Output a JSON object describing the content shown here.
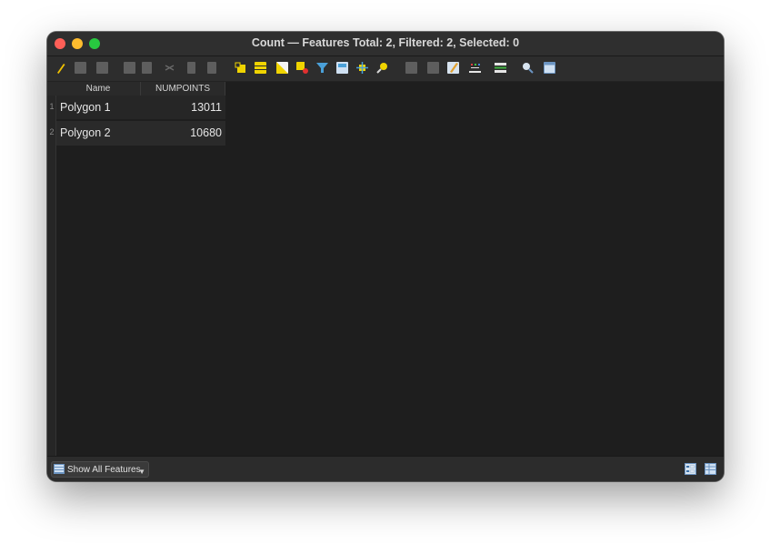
{
  "window": {
    "title": "Count — Features Total: 2, Filtered: 2, Selected: 0"
  },
  "toolbar": {
    "tools": [
      {
        "name": "toggle-editing-icon",
        "color": "#f2c200"
      },
      {
        "name": "toggle-multi-edit-icon",
        "color": "#6a6a6a"
      },
      {
        "name": "save-edits-icon",
        "color": "#6a6a6a"
      },
      {
        "name": "reload-table-icon",
        "color": "#6a6a6a"
      },
      {
        "name": "add-feature-icon",
        "color": "#6a6a6a"
      },
      {
        "name": "delete-selected-icon",
        "color": "#6a6a6a"
      },
      {
        "name": "cut-selected-icon",
        "color": "#6a6a6a"
      },
      {
        "name": "copy-selected-icon",
        "color": "#6a6a6a"
      },
      {
        "name": "paste-features-icon",
        "color": "#6a6a6a"
      },
      {
        "name": "select-by-expression-icon",
        "color": "#f0d400"
      },
      {
        "name": "select-all-icon",
        "color": "#f0d400"
      },
      {
        "name": "invert-selection-icon",
        "color": "#f0d400"
      },
      {
        "name": "deselect-all-icon",
        "color": "#f0d400"
      },
      {
        "name": "filter-select-icon",
        "color": "#f0d400"
      },
      {
        "name": "move-selection-to-top-icon",
        "color": "#4aa0d8"
      },
      {
        "name": "pan-to-selected-icon",
        "color": "#f0d400"
      },
      {
        "name": "zoom-to-selected-icon",
        "color": "#f0d400"
      },
      {
        "name": "new-field-icon",
        "color": "#6a6a6a"
      },
      {
        "name": "delete-field-icon",
        "color": "#6a6a6a"
      },
      {
        "name": "open-field-calculator-icon",
        "color": "#e0b050"
      },
      {
        "name": "conditional-formatting-icon",
        "color": "#e6e6e6"
      },
      {
        "name": "actions-icon",
        "color": "#e6e6e6"
      },
      {
        "name": "zoom-map-to-rows-icon",
        "color": "#d8e4f0"
      },
      {
        "name": "dock-attribute-table-icon",
        "color": "#cfe0f2"
      }
    ]
  },
  "table": {
    "columns": [
      "Name",
      "NUMPOINTS"
    ],
    "rows": [
      {
        "num": "1",
        "name": "Polygon 1",
        "numpoints": "13011"
      },
      {
        "num": "2",
        "name": "Polygon 2",
        "numpoints": "10680"
      }
    ]
  },
  "statusbar": {
    "filter_label": "Show All Features"
  }
}
